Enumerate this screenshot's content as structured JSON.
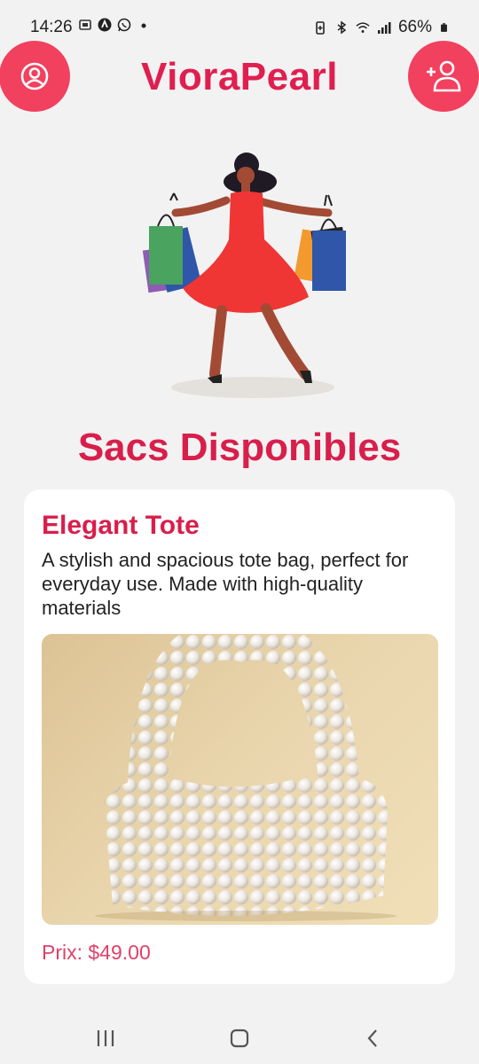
{
  "status_bar": {
    "time": "14:26",
    "battery": "66%",
    "icons_left": [
      "screenshot-icon",
      "app-icon",
      "whatsapp-icon",
      "dot-icon"
    ],
    "icons_right": [
      "battery-saver-icon",
      "bluetooth-icon",
      "wifi-icon",
      "signal-icon",
      "battery-icon"
    ]
  },
  "header": {
    "brand": "VioraPearl",
    "left_button_icon": "user-profile-icon",
    "right_button_icon": "add-user-icon",
    "accent_color": "#f2405f"
  },
  "section": {
    "title": "Sacs Disponibles"
  },
  "products": [
    {
      "name": "Elegant Tote",
      "description": "A stylish and spacious tote bag, perfect for everyday use. Made with high-quality materials",
      "price": "Prix: $49.00",
      "image": "pearl-handbag-image"
    }
  ],
  "nav_bar": {
    "items": [
      "recent-apps-icon",
      "home-icon",
      "back-icon"
    ]
  }
}
